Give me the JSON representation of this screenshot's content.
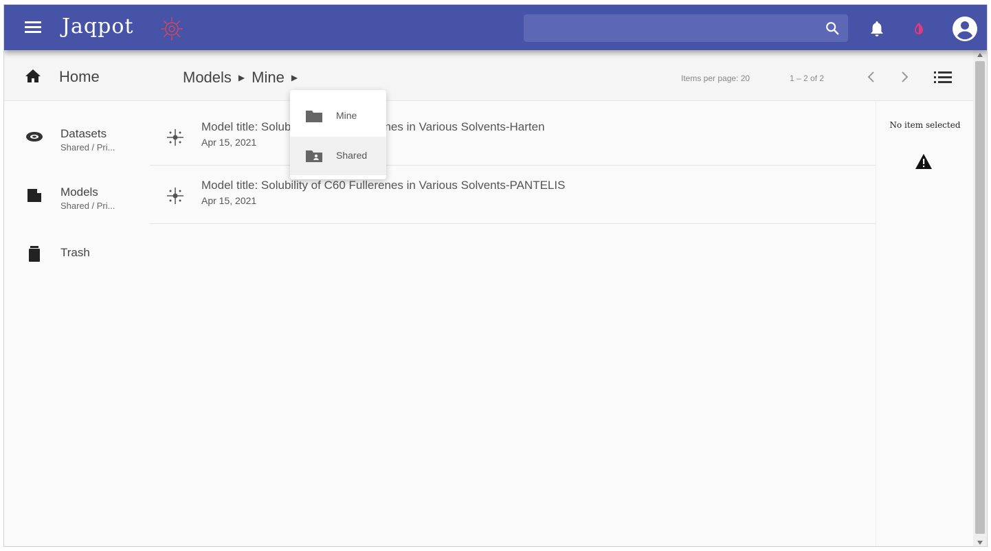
{
  "app": {
    "brand": "Jaqpot",
    "colors": {
      "topbar": "#4753a6",
      "accent": "#e23a7a"
    }
  },
  "header": {
    "icons": [
      "menu-icon",
      "logo-icon",
      "search-icon",
      "bell-icon",
      "contrast-icon",
      "account-icon"
    ],
    "search": {
      "placeholder": ""
    }
  },
  "toolbar": {
    "home_label": "Home",
    "breadcrumbs": [
      "Models",
      "Mine"
    ],
    "items_per_page": "Items per page: 20",
    "range_label": "1 – 2 of 2"
  },
  "sidebar": {
    "items": [
      {
        "title": "Datasets",
        "subtitle": "Shared / Pri...",
        "icon": "dataset-icon"
      },
      {
        "title": "Models",
        "subtitle": "Shared / Pri...",
        "icon": "model-icon"
      },
      {
        "title": "Trash",
        "subtitle": "",
        "icon": "trash-icon"
      }
    ]
  },
  "list": {
    "rows": [
      {
        "title": "Model title: Solubility of C60 Fullerenes in Various Solvents-Harten",
        "date": "Apr 15, 2021"
      },
      {
        "title": "Model title: Solubility of C60 Fullerenes in Various Solvents-PANTELIS",
        "date": "Apr 15, 2021"
      }
    ]
  },
  "dropdown": {
    "items": [
      {
        "label": "Mine",
        "icon": "folder-icon"
      },
      {
        "label": "Shared",
        "icon": "shared-folder-icon"
      }
    ]
  },
  "details": {
    "empty_label": "No item selected",
    "icon": "warning-icon"
  }
}
